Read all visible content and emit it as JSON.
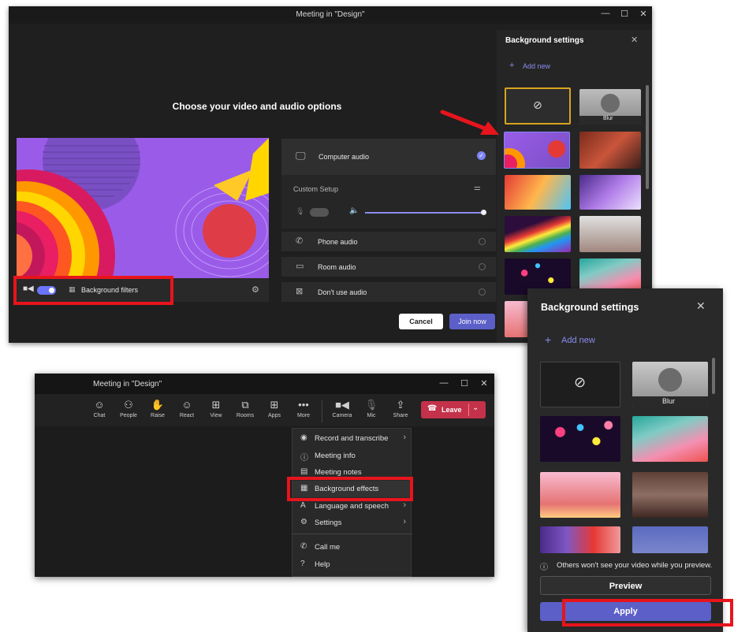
{
  "window1": {
    "title": "Meeting in \"Design\"",
    "heading": "Choose your video and audio options",
    "background_filters_label": "Background filters",
    "audio": {
      "computer_audio": "Computer audio",
      "custom_setup": "Custom Setup",
      "phone_audio": "Phone audio",
      "room_audio": "Room audio",
      "dont_use_audio": "Don't use audio",
      "volume_level": 0.95
    },
    "cancel_label": "Cancel",
    "join_label": "Join now",
    "bg_panel": {
      "title": "Background settings",
      "add_new": "Add new",
      "blur_label": "Blur"
    }
  },
  "window2": {
    "title": "Meeting in \"Design\"",
    "toolbar": [
      "Chat",
      "People",
      "Raise",
      "React",
      "View",
      "Rooms",
      "Apps",
      "More",
      "Camera",
      "Mic",
      "Share"
    ],
    "leave_label": "Leave",
    "menu": [
      {
        "label": "Record and transcribe",
        "submenu": true
      },
      {
        "label": "Meeting info",
        "submenu": false
      },
      {
        "label": "Meeting notes",
        "submenu": false
      },
      {
        "label": "Background effects",
        "submenu": false
      },
      {
        "label": "Language and speech",
        "submenu": true
      },
      {
        "label": "Settings",
        "submenu": true
      },
      {
        "label": "Call me",
        "submenu": false
      },
      {
        "label": "Help",
        "submenu": false
      }
    ]
  },
  "panel3": {
    "title": "Background settings",
    "add_new": "Add new",
    "blur_label": "Blur",
    "notice": "Others won't see your video while you preview.",
    "preview_label": "Preview",
    "apply_label": "Apply"
  },
  "colors": {
    "accent": "#5b5fc7",
    "highlight": "#e8141c",
    "leave": "#c4314b",
    "selected_border": "#d9a520"
  }
}
